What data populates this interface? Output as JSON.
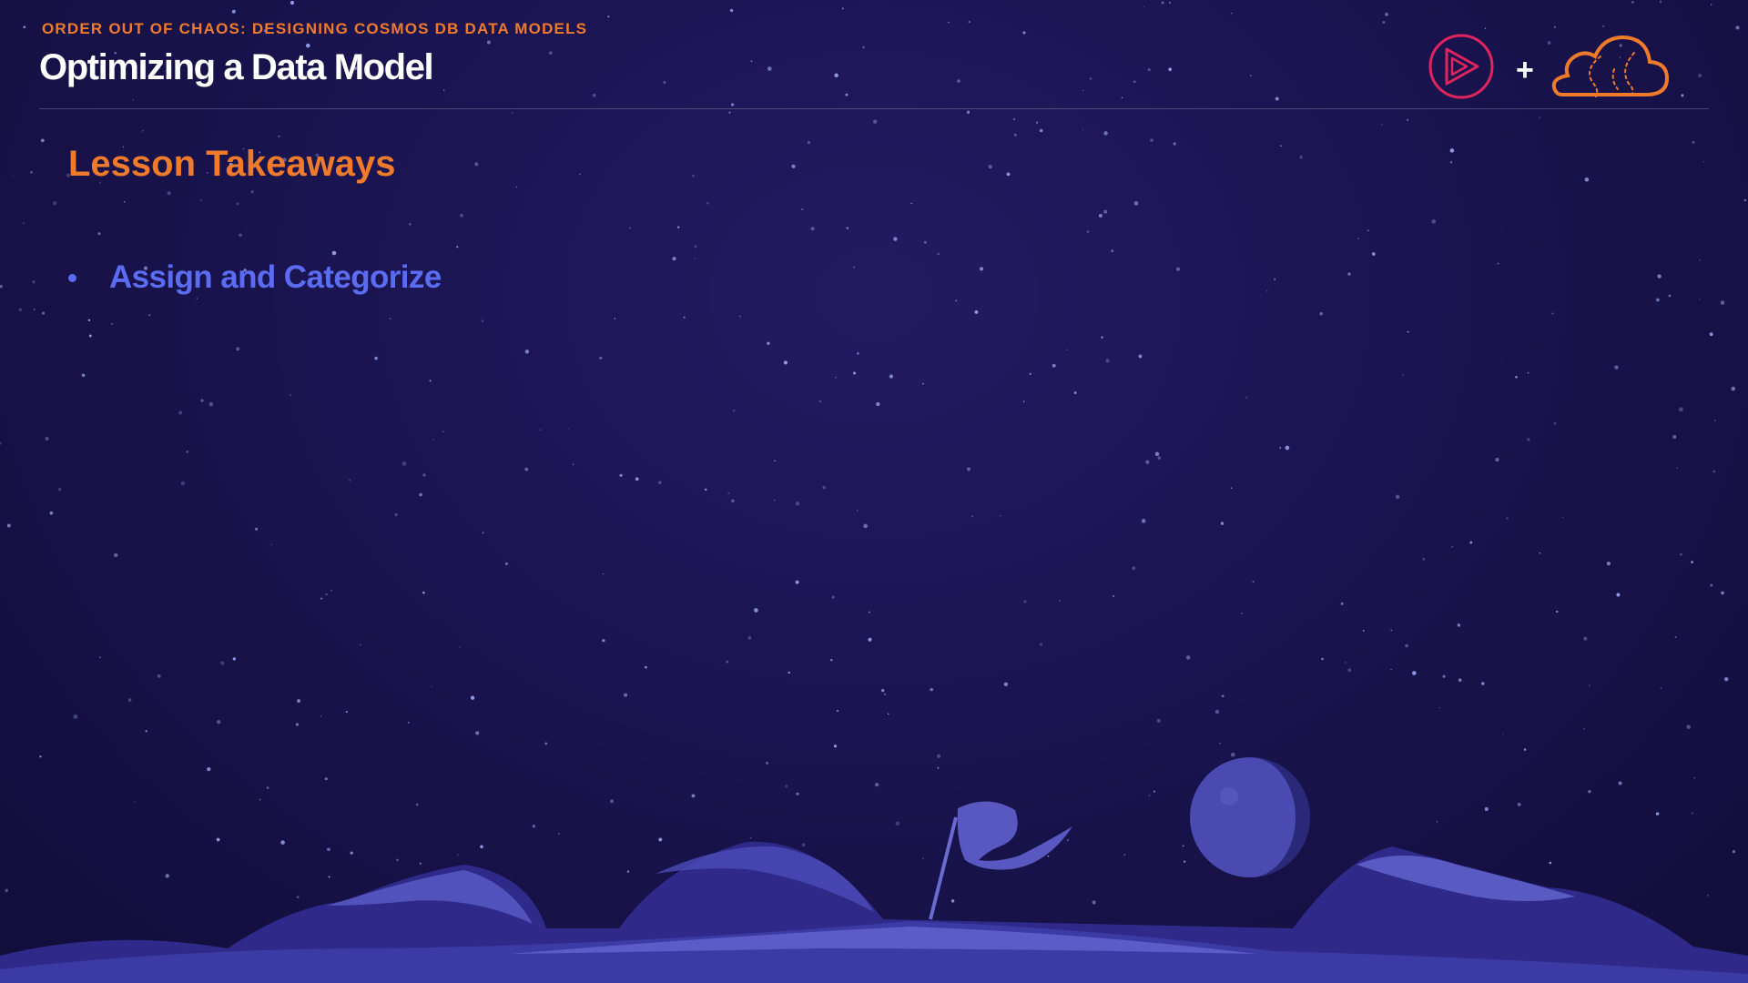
{
  "header": {
    "eyebrow": "ORDER OUT OF CHAOS: DESIGNING COSMOS DB DATA MODELS",
    "title": "Optimizing a Data Model",
    "logos": [
      "play-logo-icon",
      "plus-icon",
      "cloud-logo-icon"
    ],
    "logo_plus": "+"
  },
  "content": {
    "section_title": "Lesson Takeaways",
    "bullets": [
      {
        "label": "Assign and Categorize"
      }
    ]
  },
  "colors": {
    "background": "#1a1450",
    "accent_orange": "#f07a2c",
    "bullet_blue": "#5b6cf2",
    "logo_red": "#e0245e"
  }
}
